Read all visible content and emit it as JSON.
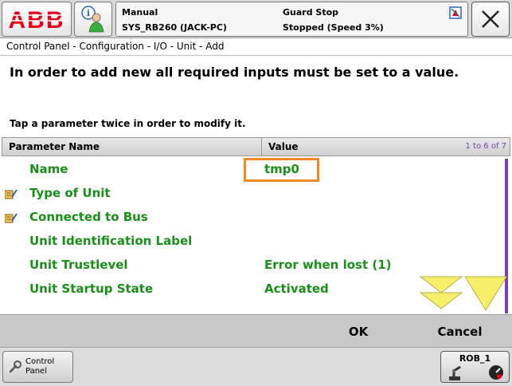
{
  "header": {
    "logo_text": "ABB",
    "mode": "Manual",
    "system": "SYS_RB260 (JACK-PC)",
    "guard": "Guard Stop",
    "state": "Stopped (Speed 3%)",
    "icons": {
      "info": "info-person-icon",
      "status": "status-indicator-icon",
      "close": "close-icon"
    }
  },
  "breadcrumb": "Control Panel - Configuration - I/O - Unit - Add",
  "instruction": "In order to add new all required inputs must be set to a value.",
  "tap_hint": "Tap a parameter twice in order to modify it.",
  "table": {
    "col_name": "Parameter Name",
    "col_value": "Value",
    "page_count": "1 to 6 of 7",
    "rows": [
      {
        "name": "Name",
        "value": "tmp0",
        "required": false
      },
      {
        "name": "Type of Unit",
        "value": "",
        "required": true
      },
      {
        "name": "Connected to Bus",
        "value": "",
        "required": true
      },
      {
        "name": "Unit Identification Label",
        "value": "",
        "required": false
      },
      {
        "name": "Unit Trustlevel",
        "value": "Error when lost (1)",
        "required": false
      },
      {
        "name": "Unit Startup State",
        "value": "Activated",
        "required": false
      }
    ]
  },
  "actions": {
    "ok": "OK",
    "cancel": "Cancel"
  },
  "taskbar": {
    "control_panel": "Control Panel",
    "rob": "ROB_1"
  },
  "colors": {
    "value_green": "#189018",
    "highlight_orange": "#f08a24",
    "scroll_yellow": "#f5ef6a",
    "abb_red": "#e2001a"
  }
}
